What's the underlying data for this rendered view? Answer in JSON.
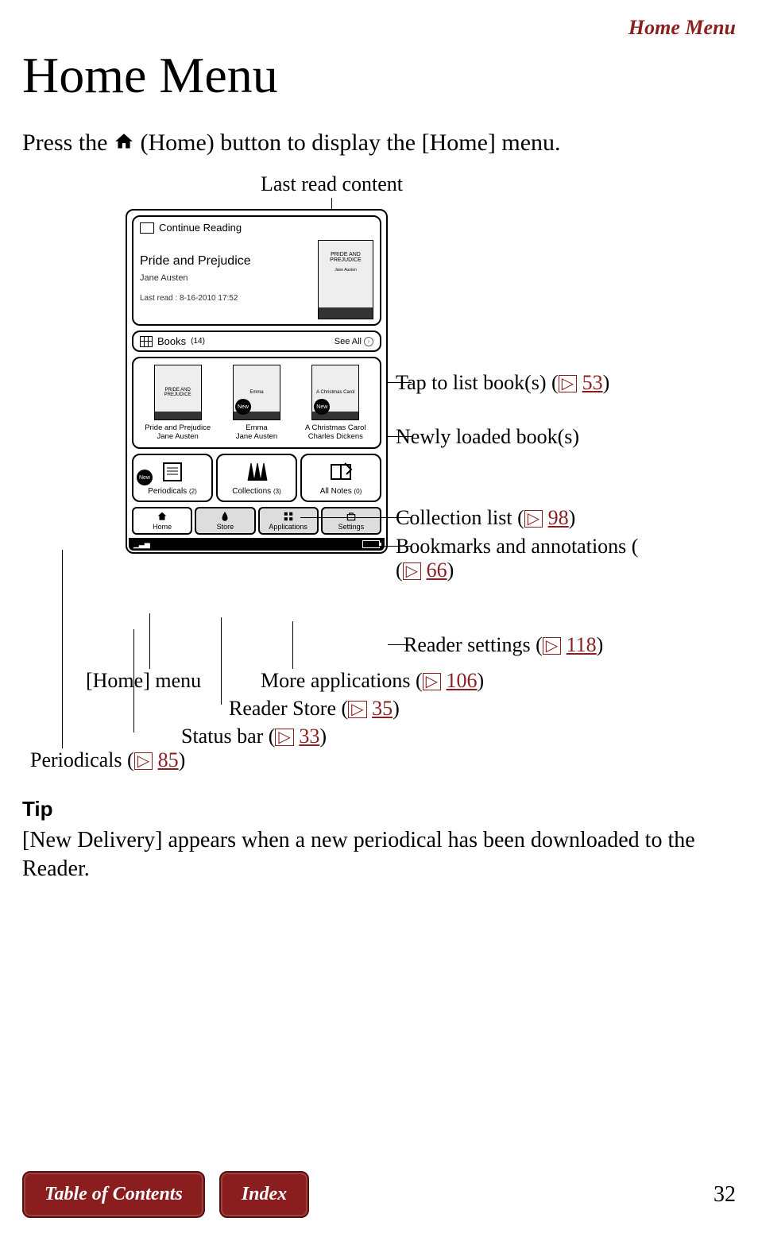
{
  "header": {
    "section": "Home Menu"
  },
  "title": "Home Menu",
  "intro": {
    "pre": "Press the ",
    "mid": " (Home) button to display the [Home] menu.",
    "home_icon": "home-icon"
  },
  "callouts": {
    "top": "Last read content",
    "see_all": {
      "pre": "Tap to list book(s) (",
      "page": "53",
      "post": ")"
    },
    "newly": "Newly loaded book(s)",
    "collections": {
      "pre": "Collection list (",
      "page": "98",
      "post": ")"
    },
    "notes": {
      "pre": "Bookmarks and annotations (",
      "page": "66",
      "post": ")"
    },
    "settings": {
      "pre": "Reader settings (",
      "page": "118",
      "post": ")"
    },
    "home_menu": "[Home] menu",
    "more_apps": {
      "pre": "More applications (",
      "page": "106",
      "post": ")"
    },
    "reader_store": {
      "pre": "Reader Store (",
      "page": "35",
      "post": ")"
    },
    "status_bar": {
      "pre": "Status bar (",
      "page": "33",
      "post": ")"
    },
    "periodicals": {
      "pre": "Periodicals (",
      "page": "85",
      "post": ")"
    }
  },
  "device": {
    "continue_reading": {
      "label": "Continue Reading",
      "title": "Pride and Prejudice",
      "author": "Jane Austen",
      "last_read": "Last read : 8-16-2010 17:52",
      "cover_text": "PRIDE AND PREJUDICE",
      "cover_author": "Jane Austen"
    },
    "books": {
      "label": "Books",
      "count": "(14)",
      "see_all": "See All",
      "items": [
        {
          "cover": "PRIDE AND PREJUDICE",
          "title": "Pride and Prejudice",
          "author": "Jane Austen",
          "new": false
        },
        {
          "cover": "Emma",
          "title": "Emma",
          "author": "Jane Austen",
          "new": true
        },
        {
          "cover": "A Christmas Carol",
          "title": "A Christmas Carol",
          "author": "Charles Dickens",
          "new": true
        }
      ],
      "new_badge": "New"
    },
    "tiles": {
      "periodicals": {
        "label": "Periodicals",
        "count": "(2)",
        "new": true,
        "new_badge": "New"
      },
      "collections": {
        "label": "Collections",
        "count": "(3)"
      },
      "notes": {
        "label": "All Notes",
        "count": "(0)"
      }
    },
    "tabs": {
      "home": "Home",
      "store": "Store",
      "apps": "Applications",
      "settings": "Settings"
    }
  },
  "tip": {
    "heading": "Tip",
    "body": "[New Delivery] appears when a new periodical has been downloaded to the Reader."
  },
  "footer": {
    "toc": "Table of Contents",
    "index": "Index",
    "page": "32"
  }
}
